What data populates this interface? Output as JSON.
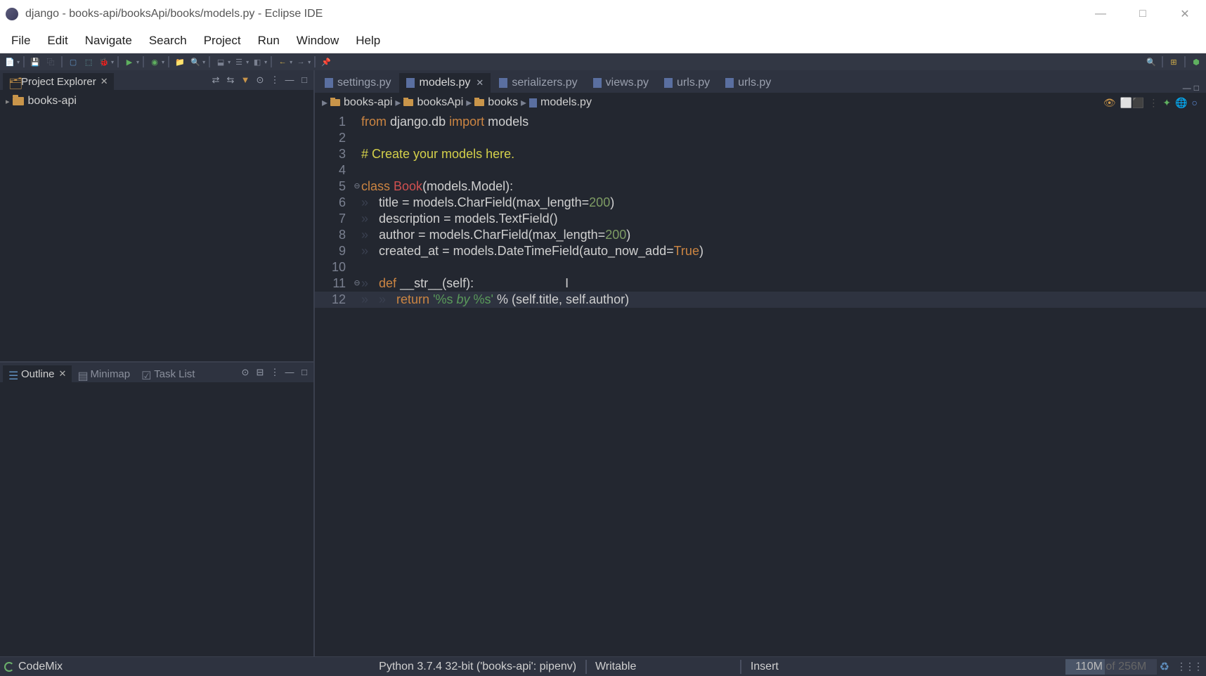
{
  "window": {
    "title": "django - books-api/booksApi/books/models.py - Eclipse IDE"
  },
  "menubar": [
    "File",
    "Edit",
    "Navigate",
    "Search",
    "Project",
    "Run",
    "Window",
    "Help"
  ],
  "explorer": {
    "title": "Project Explorer",
    "root": "books-api"
  },
  "outline": {
    "tabs": [
      "Outline",
      "Minimap",
      "Task List"
    ]
  },
  "editor_tabs": [
    {
      "label": "settings.py",
      "active": false,
      "closeable": false
    },
    {
      "label": "models.py",
      "active": true,
      "closeable": true
    },
    {
      "label": "serializers.py",
      "active": false,
      "closeable": false
    },
    {
      "label": "views.py",
      "active": false,
      "closeable": false
    },
    {
      "label": "urls.py",
      "active": false,
      "closeable": false
    },
    {
      "label": "urls.py",
      "active": false,
      "closeable": false
    }
  ],
  "breadcrumb": [
    "books-api",
    "booksApi",
    "books",
    "models.py"
  ],
  "code_lines": [
    {
      "n": 1,
      "fold": "",
      "html": "<span class='kw'>from</span><span class='txt'>&nbsp;django.db&nbsp;</span><span class='kw'>import</span><span class='txt'>&nbsp;models</span>"
    },
    {
      "n": 2,
      "fold": "",
      "html": ""
    },
    {
      "n": 3,
      "fold": "",
      "html": "<span class='cmt'># Create your models here.</span>"
    },
    {
      "n": 4,
      "fold": "",
      "html": ""
    },
    {
      "n": 5,
      "fold": "⊖",
      "html": "<span class='kw'>class</span><span class='txt'>&nbsp;</span><span class='cls'>Book</span><span class='txt'>(models.Model):</span>"
    },
    {
      "n": 6,
      "fold": "",
      "html": "<span class='ws'>»   </span><span class='txt'>title = models.CharField(max_length=</span><span class='num'>200</span><span class='txt'>)</span>"
    },
    {
      "n": 7,
      "fold": "",
      "html": "<span class='ws'>»   </span><span class='txt'>description = models.TextField()</span>"
    },
    {
      "n": 8,
      "fold": "",
      "html": "<span class='ws'>»   </span><span class='txt'>author = models.CharField(max_length=</span><span class='num'>200</span><span class='txt'>)</span>"
    },
    {
      "n": 9,
      "fold": "",
      "html": "<span class='ws'>»   </span><span class='txt'>created_at = models.DateTimeField(auto_now_add=</span><span class='bool'>True</span><span class='txt'>)</span>"
    },
    {
      "n": 10,
      "fold": "",
      "html": ""
    },
    {
      "n": 11,
      "fold": "⊖",
      "html": "<span class='ws'>»   </span><span class='kw'>def</span><span class='txt'>&nbsp;</span><span class='fn'>__str__</span><span class='txt'>(self):</span><span class='txt'>                          </span><span class='cursor-beam'>I</span>"
    },
    {
      "n": 12,
      "fold": "",
      "html": "<span class='ws'>»   »   </span><span class='kw'>return</span><span class='txt'>&nbsp;</span><span class='str2'>'%s </span><span class='str'>by</span><span class='str2'> %s'</span><span class='txt'> % (self.title, self.author)</span>",
      "hl": true
    }
  ],
  "statusbar": {
    "codemix": "CodeMix",
    "python": "Python 3.7.4 32-bit ('books-api': pipenv)",
    "writable": "Writable",
    "insert": "Insert",
    "heap_used": "110M",
    "heap_total": "of 256M"
  }
}
